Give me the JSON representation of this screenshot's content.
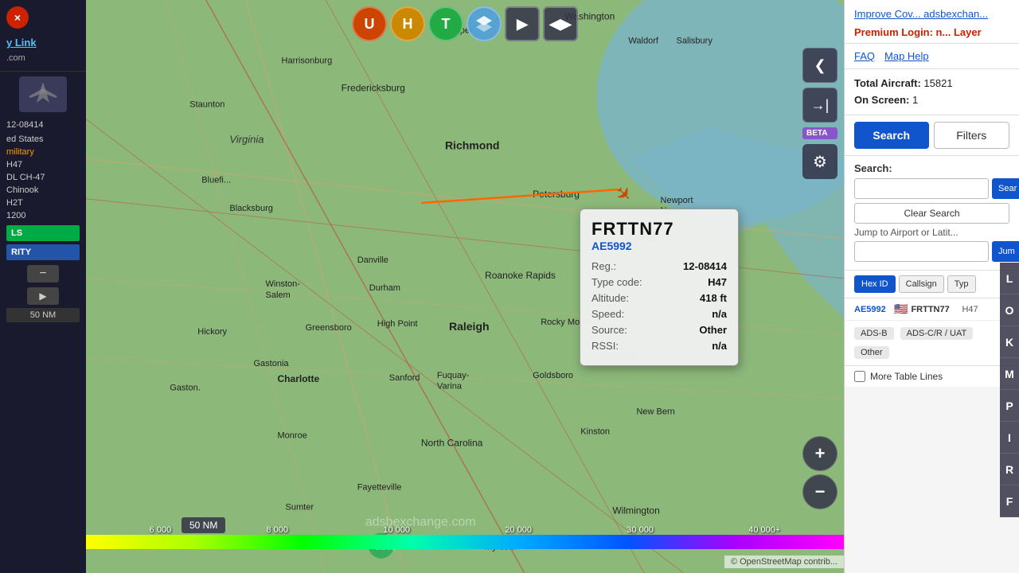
{
  "sidebar": {
    "close_label": "×",
    "link_label": "y Link",
    "subdomain": ".com",
    "reg": "12-08414",
    "country": "ed States",
    "type_label": "military",
    "type_code": "H47",
    "model": "DL CH-47",
    "model2": "Chinook",
    "h2t": "H2T",
    "squawk": "1200",
    "tag1": "LS",
    "tag2": "RITY",
    "distance": "50 NM"
  },
  "aircraft_popup": {
    "callsign": "FRTTN77",
    "hex": "AE5992",
    "reg_label": "Reg.:",
    "reg_value": "12-08414",
    "type_label": "Type code:",
    "type_value": "H47",
    "altitude_label": "Altitude:",
    "altitude_value": "418 ft",
    "speed_label": "Speed:",
    "speed_value": "n/a",
    "source_label": "Source:",
    "source_value": "Other",
    "rssi_label": "RSSI:",
    "rssi_value": "n/a"
  },
  "map_controls": {
    "btn_u": "U",
    "btn_h": "H",
    "btn_t": "T",
    "btn_next": "▶",
    "btn_split": "◀▶",
    "btn_back": "❮",
    "beta": "BETA",
    "zoom_plus": "+",
    "zoom_minus": "−",
    "distance": "50 NM"
  },
  "color_bar": {
    "labels": [
      "6 000",
      "8 000",
      "10 000",
      "20 000",
      "30 000",
      "40 000+"
    ]
  },
  "attribution": {
    "text": "© OpenStreetMap contrib...",
    "watermark": "adsbexchange.com"
  },
  "right_panel": {
    "improve_link": "Improve Cov... adsbexchan...",
    "premium_label": "Premium Login: n... Layer",
    "faq_label": "FAQ",
    "map_help_label": "Map Help",
    "total_aircraft_label": "Total Aircraft:",
    "total_aircraft_value": "15821",
    "on_screen_label": "On Screen:",
    "on_screen_value": "1",
    "search_btn": "Search",
    "filters_btn": "Filters",
    "search_section_label": "Search:",
    "search_input_placeholder": "",
    "search_mini_label": "Sear",
    "clear_search_label": "Clear Search",
    "jump_label": "Jump to Airport or Latit...",
    "jump_input_placeholder": "",
    "jump_btn_label": "Jum",
    "table_cols": [
      "Hex ID",
      "Callsign",
      "Typ"
    ],
    "aircraft_row": {
      "hex": "AE5992",
      "flag": "🇺🇸",
      "callsign": "FRTTN77",
      "type": "H47"
    },
    "source_options": [
      "ADS-B",
      "ADS-C/R / UAT"
    ],
    "other_label": "Other",
    "more_lines_label": "More Table Lines"
  },
  "nav_buttons": [
    "L",
    "O",
    "K",
    "M",
    "P",
    "I",
    "R",
    "F"
  ]
}
